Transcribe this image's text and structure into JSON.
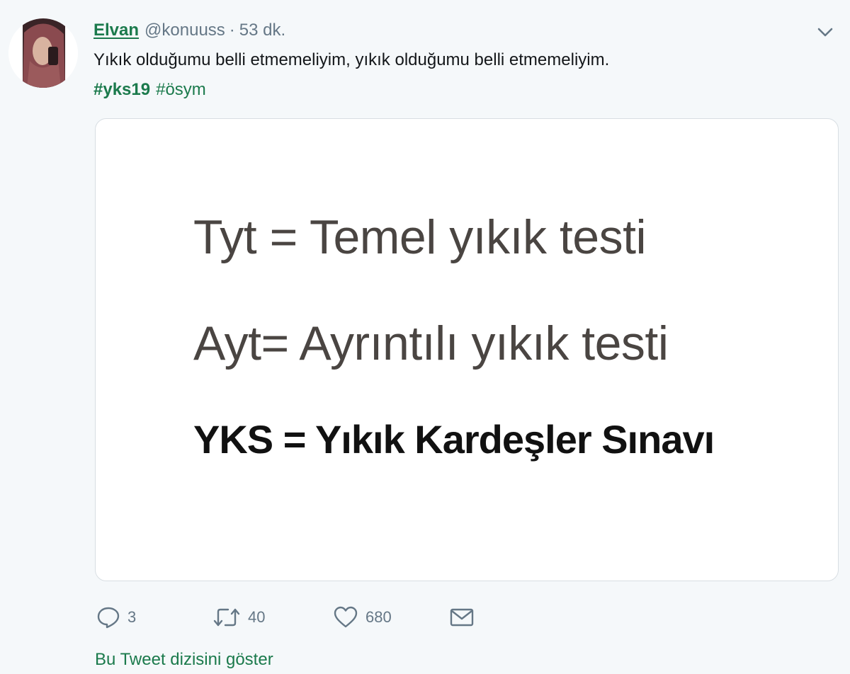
{
  "tweet": {
    "display_name": "Elvan",
    "handle": "@konuuss",
    "separator": "·",
    "time": "53 dk.",
    "text": "Yıkık olduğumu belli etmemeliyim, yıkık olduğumu belli etmemeliyim.",
    "hashtags": [
      "#yks19",
      "#ösym"
    ],
    "media_lines": [
      "Tyt = Temel yıkık testi",
      "Ayt= Ayrıntılı yıkık testi",
      "YKS = Yıkık Kardeşler Sınavı"
    ],
    "actions": {
      "reply_count": "3",
      "retweet_count": "40",
      "like_count": "680"
    },
    "thread_link": "Bu Tweet dizisini göster"
  },
  "icons": {
    "menu": "chevron-down-icon",
    "reply": "speech-bubble-icon",
    "retweet": "retweet-arrows-icon",
    "like": "heart-icon",
    "dm": "envelope-icon"
  },
  "colors": {
    "accent": "#1b7a4c",
    "muted": "#657786",
    "text": "#14171a",
    "background": "#f5f8fa"
  }
}
